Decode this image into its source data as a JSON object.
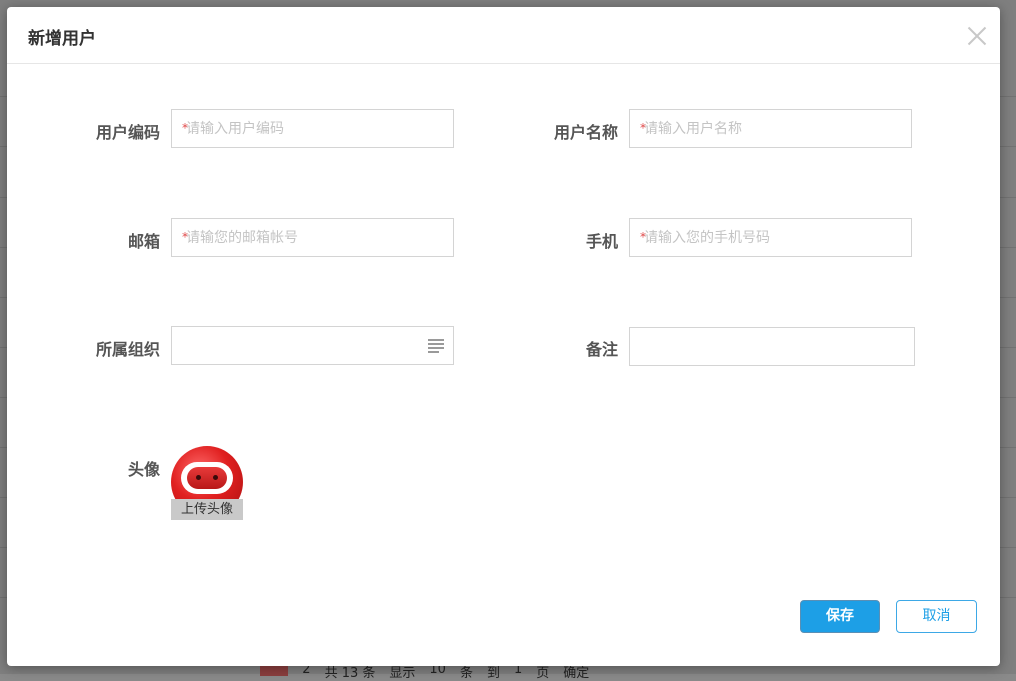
{
  "dialog": {
    "title": "新增用户",
    "close_icon": "close-icon"
  },
  "form": {
    "user_code": {
      "label": "用户编码",
      "placeholder": "请输入用户编码",
      "required": true
    },
    "user_name": {
      "label": "用户名称",
      "placeholder": "请输入用户名称",
      "required": true
    },
    "email": {
      "label": "邮箱",
      "placeholder": "请输您的邮箱帐号",
      "required": true
    },
    "phone": {
      "label": "手机",
      "placeholder": "请输入您的手机号码",
      "required": true
    },
    "org": {
      "label": "所属组织",
      "value": "",
      "icon": "list-select-icon"
    },
    "remark": {
      "label": "备注",
      "value": ""
    },
    "avatar": {
      "label": "头像",
      "upload_label": "上传头像"
    }
  },
  "actions": {
    "save_label": "保存",
    "cancel_label": "取消"
  },
  "background_pager": {
    "page_active": "1",
    "page_next": "2",
    "total_text": "共 13 条",
    "show_text": "显示",
    "page_size": "10",
    "unit_text": "条",
    "goto_text": "到",
    "goto_page": "1",
    "page_text": "页",
    "confirm_text": "确定"
  },
  "colors": {
    "primary": "#1d9fe6",
    "required": "#e24b4b",
    "overlay": "#7f7f7f"
  }
}
